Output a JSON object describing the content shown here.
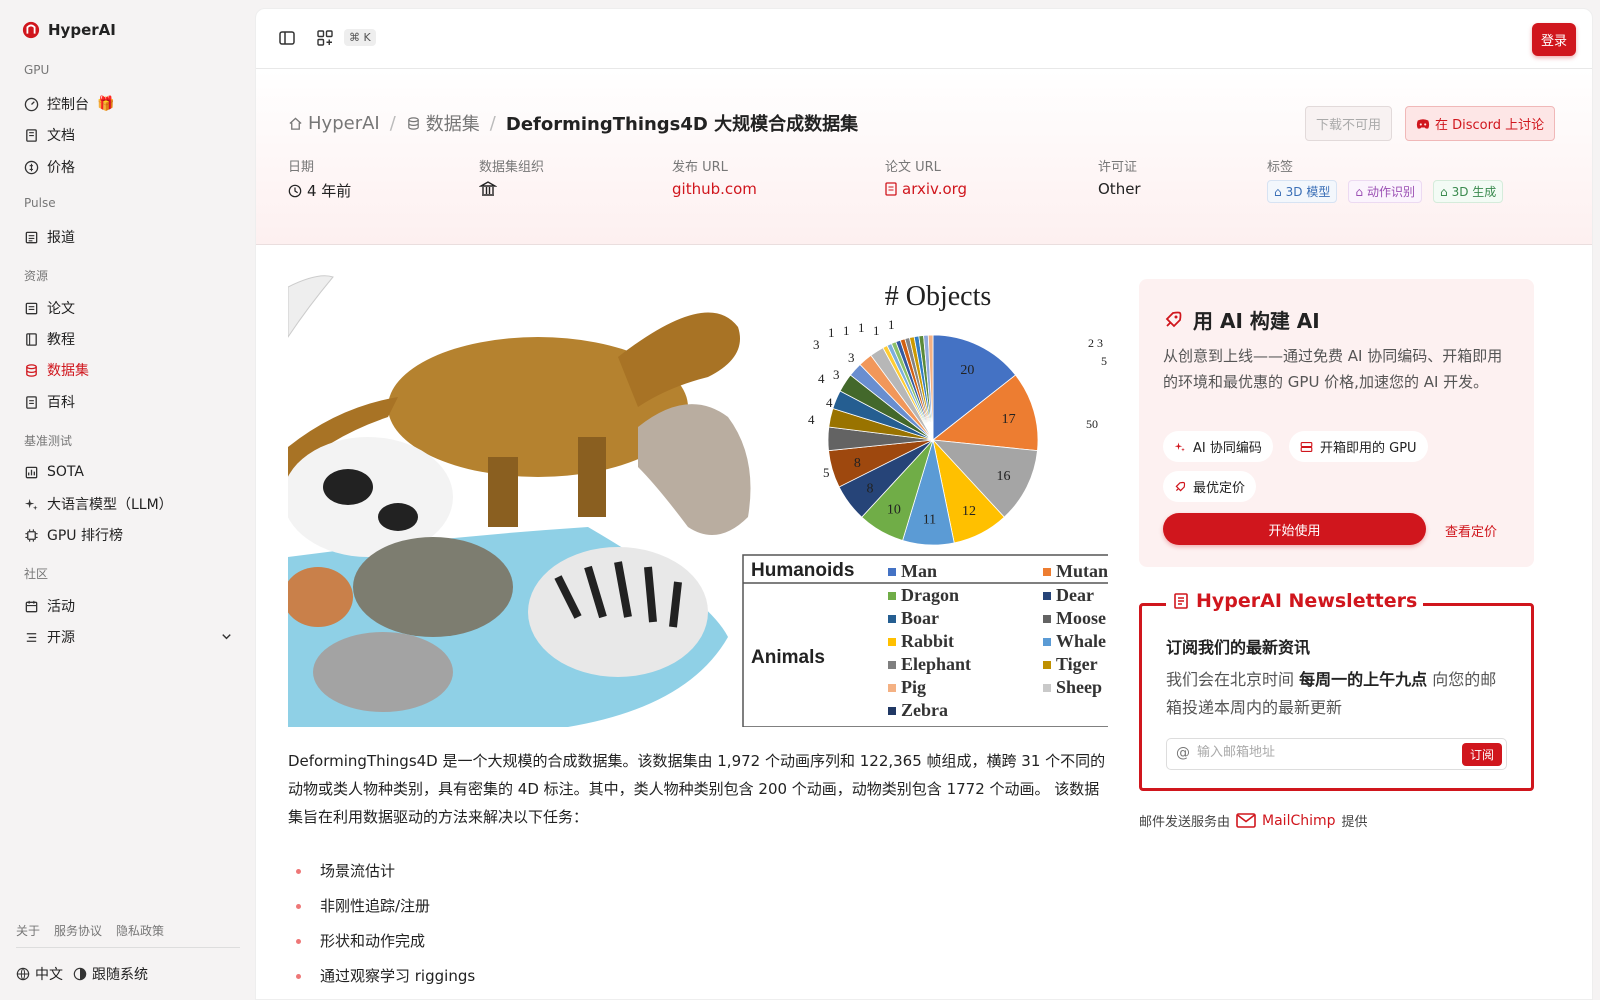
{
  "brand": {
    "name": "HyperAI"
  },
  "sidebar": {
    "sections": [
      {
        "label": "GPU",
        "items": [
          {
            "label": "控制台",
            "icon": "gauge-icon"
          },
          {
            "label": "文档",
            "icon": "book-icon"
          },
          {
            "label": "价格",
            "icon": "price-icon"
          }
        ]
      },
      {
        "label": "Pulse",
        "items": [
          {
            "label": "报道",
            "icon": "news-icon"
          }
        ]
      },
      {
        "label": "资源",
        "items": [
          {
            "label": "论文",
            "icon": "paper-icon"
          },
          {
            "label": "教程",
            "icon": "tutorial-icon"
          },
          {
            "label": "数据集",
            "icon": "database-icon",
            "active": true
          },
          {
            "label": "百科",
            "icon": "wiki-icon"
          }
        ]
      },
      {
        "label": "基准测试",
        "items": [
          {
            "label": "SOTA",
            "icon": "chart-icon"
          },
          {
            "label": "大语言模型（LLM）",
            "icon": "sparkle-icon"
          },
          {
            "label": "GPU 排行榜",
            "icon": "chip-icon"
          }
        ]
      },
      {
        "label": "社区",
        "items": [
          {
            "label": "活动",
            "icon": "calendar-icon"
          },
          {
            "label": "开源",
            "icon": "list-icon"
          }
        ]
      }
    ],
    "footer_links": [
      "关于",
      "服务协议",
      "隐私政策"
    ],
    "language": "中文",
    "theme": "跟随系统"
  },
  "topbar": {
    "shortcut": "⌘ K",
    "login_label": "登录"
  },
  "breadcrumb": {
    "home": "HyperAI",
    "section": "数据集",
    "current": "DeformingThings4D 大规模合成数据集"
  },
  "actions": {
    "download": "下载不可用",
    "discord": "在 Discord 上讨论"
  },
  "meta": {
    "date_label": "日期",
    "date_value": "4 年前",
    "org_label": "数据集组织",
    "publish_label": "发布 URL",
    "publish_value": "github.com",
    "paper_label": "论文 URL",
    "paper_value": "arxiv.org",
    "license_label": "许可证",
    "license_value": "Other",
    "tags_label": "标签",
    "tags": [
      "3D 模型",
      "动作识别",
      "3D 生成"
    ]
  },
  "figure": {
    "title": "# Objects",
    "pie_values": [
      20,
      17,
      16,
      12,
      11,
      10,
      8,
      8,
      5,
      4,
      4,
      4,
      3,
      3,
      3,
      1,
      1,
      1,
      1,
      1,
      1,
      1,
      1,
      1,
      1,
      1
    ],
    "left_labels": [
      "3",
      "1",
      "1",
      "1",
      "1",
      "1",
      "3",
      "3",
      "4",
      "4",
      "4",
      "5"
    ],
    "right_top": "2 3",
    "right_mid": "5",
    "right_side": "50",
    "legend_groups": [
      {
        "group": "Humanoids",
        "entries": [
          {
            "name": "Man",
            "color": "#4472c4"
          },
          {
            "name": "Mutan",
            "color": "#ed7d31"
          }
        ]
      },
      {
        "group": "Animals",
        "entries": [
          {
            "name": "Dragon",
            "color": "#70ad47"
          },
          {
            "name": "Dear",
            "color": "#264478"
          },
          {
            "name": "Boar",
            "color": "#255e91"
          },
          {
            "name": "Moose",
            "color": "#636363"
          },
          {
            "name": "Rabbit",
            "color": "#ffc000"
          },
          {
            "name": "Whale",
            "color": "#5b9bd5"
          },
          {
            "name": "Elephant",
            "color": "#7f7f7f"
          },
          {
            "name": "Tiger",
            "color": "#bf9000"
          },
          {
            "name": "Pig",
            "color": "#f4b183"
          },
          {
            "name": "Sheep",
            "color": "#c9c9c9"
          },
          {
            "name": "Zebra",
            "color": "#203864"
          }
        ]
      }
    ]
  },
  "description": "DeformingThings4D 是一个大规模的合成数据集。该数据集由 1,972 个动画序列和 122,365 帧组成，横跨 31 个不同的动物或类人物种类别，具有密集的 4D 标注。其中，类人物种类别包含 200 个动画，动物类别包含 1772 个动画。 该数据集旨在利用数据驱动的方法来解决以下任务：",
  "tasks": [
    "场景流估计",
    "非刚性追踪/注册",
    "形状和动作完成",
    "通过观察学习 riggings"
  ],
  "ai_card": {
    "title": "用 AI 构建 AI",
    "text": "从创意到上线——通过免费 AI 协同编码、开箱即用的环境和最优惠的 GPU 价格,加速您的 AI 开发。",
    "pills": [
      "AI 协同编码",
      "开箱即用的 GPU",
      "最优定价"
    ],
    "start_label": "开始使用",
    "price_label": "查看定价"
  },
  "newsletter": {
    "title": "HyperAI Newsletters",
    "subtitle": "订阅我们的最新资讯",
    "text_pre": "我们会在北京时间 ",
    "text_bold": "每周一的上午九点",
    "text_post": " 向您的邮箱投递本周内的最新更新",
    "placeholder": "输入邮箱地址",
    "subscribe_label": "订阅",
    "provider_pre": "邮件发送服务由",
    "provider": "MailChimp",
    "provider_post": "提供"
  },
  "colors": {
    "accent": "#d0161d"
  }
}
